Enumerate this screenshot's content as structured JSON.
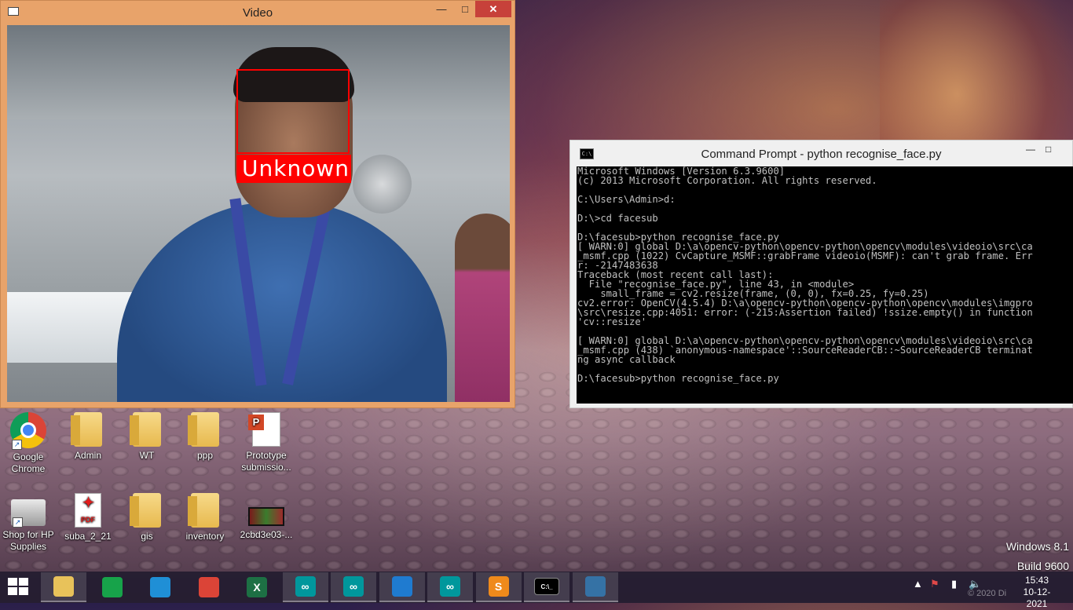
{
  "video_window": {
    "title": "Video",
    "face_label": "Unknown"
  },
  "cmd_window": {
    "title": "Command Prompt - python  recognise_face.py",
    "icon_text": "C:\\",
    "lines": [
      "Microsoft Windows [Version 6.3.9600]",
      "(c) 2013 Microsoft Corporation. All rights reserved.",
      "",
      "C:\\Users\\Admin>d:",
      "",
      "D:\\>cd facesub",
      "",
      "D:\\facesub>python recognise_face.py",
      "[ WARN:0] global D:\\a\\opencv-python\\opencv-python\\opencv\\modules\\videoio\\src\\ca",
      "_msmf.cpp (1022) CvCapture_MSMF::grabFrame videoio(MSMF): can't grab frame. Err",
      "r: -2147483638",
      "Traceback (most recent call last):",
      "  File \"recognise_face.py\", line 43, in <module>",
      "    small_frame = cv2.resize(frame, (0, 0), fx=0.25, fy=0.25)",
      "cv2.error: OpenCV(4.5.4) D:\\a\\opencv-python\\opencv-python\\opencv\\modules\\imgpro",
      "\\src\\resize.cpp:4051: error: (-215:Assertion failed) !ssize.empty() in function",
      "'cv::resize'",
      "",
      "[ WARN:0] global D:\\a\\opencv-python\\opencv-python\\opencv\\modules\\videoio\\src\\ca",
      "_msmf.cpp (438) `anonymous-namespace'::SourceReaderCB::~SourceReaderCB terminat",
      "ng async callback",
      "",
      "D:\\facesub>python recognise_face.py"
    ]
  },
  "desktop_icons": [
    {
      "label": "Google Chrome",
      "type": "chrome",
      "icon": "chrome-icon",
      "shortcut": true
    },
    {
      "label": "Admin",
      "type": "folder",
      "icon": "user-folder-icon",
      "shortcut": false
    },
    {
      "label": "WT",
      "type": "folder",
      "icon": "folder-icon",
      "shortcut": false
    },
    {
      "label": "ppp",
      "type": "folder",
      "icon": "folder-icon",
      "shortcut": false
    },
    {
      "label": "Prototype submissio...",
      "type": "pptdoc",
      "icon": "powerpoint-icon",
      "shortcut": false
    },
    {
      "label": "Shop for HP Supplies",
      "type": "printer",
      "icon": "printer-icon",
      "shortcut": true
    },
    {
      "label": "suba_2_21",
      "type": "pdf",
      "icon": "pdf-icon",
      "shortcut": false,
      "badge": "PDF"
    },
    {
      "label": "gis",
      "type": "folder",
      "icon": "folder-icon",
      "shortcut": false
    },
    {
      "label": "inventory",
      "type": "folder",
      "icon": "folder-icon",
      "shortcut": false
    },
    {
      "label": "2cbd3e03-...",
      "type": "video",
      "icon": "video-file-icon",
      "shortcut": false
    }
  ],
  "watermark": {
    "line1": "Windows 8.1",
    "line2": "Build 9600"
  },
  "taskbar": {
    "apps": [
      {
        "name": "file-explorer",
        "glyph": "",
        "color": "#e8c25a",
        "running": true
      },
      {
        "name": "store",
        "glyph": "",
        "color": "#17a34a",
        "running": false
      },
      {
        "name": "edge",
        "glyph": "",
        "color": "#1f8fd6",
        "running": false
      },
      {
        "name": "chrome",
        "glyph": "",
        "color": "#db4437",
        "running": false
      },
      {
        "name": "excel",
        "glyph": "X",
        "color": "#1d7044",
        "running": false
      },
      {
        "name": "arduino",
        "glyph": "∞",
        "color": "#00979c",
        "running": true
      },
      {
        "name": "arduino-2",
        "glyph": "∞",
        "color": "#00979c",
        "running": true
      },
      {
        "name": "vscode",
        "glyph": "",
        "color": "#1f7bd0",
        "running": true
      },
      {
        "name": "arduino-3",
        "glyph": "∞",
        "color": "#00979c",
        "running": true
      },
      {
        "name": "sublime-text",
        "glyph": "S",
        "color": "#ef8a1b",
        "running": true
      },
      {
        "name": "command-prompt",
        "glyph": "C:\\_",
        "color": "#000000",
        "running": true
      },
      {
        "name": "python",
        "glyph": "",
        "color": "#3572a5",
        "running": true
      }
    ],
    "time": "15:43",
    "date": "10-12-2021",
    "copyright": "© 2020 Di"
  },
  "colors": {
    "face_box": "#ff0000",
    "video_frame_border": "#e8a36a",
    "close_button": "#c7413a",
    "terminal_bg": "#000000",
    "terminal_text": "#c0c0c0"
  }
}
